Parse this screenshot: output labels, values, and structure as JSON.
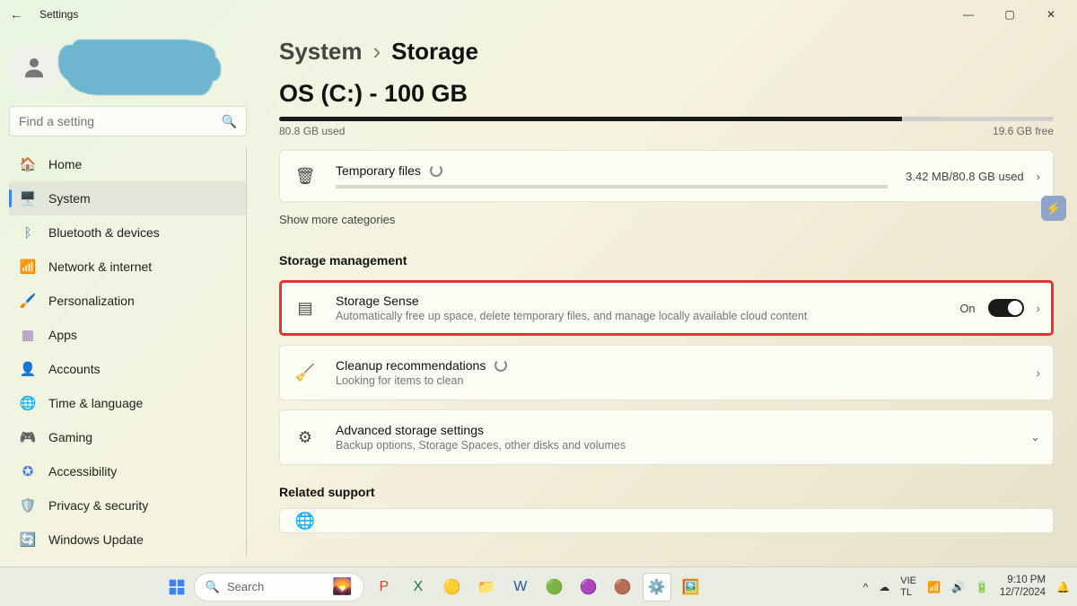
{
  "window": {
    "title": "Settings"
  },
  "search": {
    "placeholder": "Find a setting"
  },
  "sidebar": {
    "items": [
      {
        "icon": "🏠",
        "label": "Home"
      },
      {
        "icon": "🖥️",
        "label": "System"
      },
      {
        "icon": "ᛒ",
        "label": "Bluetooth & devices"
      },
      {
        "icon": "📶",
        "label": "Network & internet"
      },
      {
        "icon": "🖌️",
        "label": "Personalization"
      },
      {
        "icon": "▦",
        "label": "Apps"
      },
      {
        "icon": "👤",
        "label": "Accounts"
      },
      {
        "icon": "🌐",
        "label": "Time & language"
      },
      {
        "icon": "🎮",
        "label": "Gaming"
      },
      {
        "icon": "✪",
        "label": "Accessibility"
      },
      {
        "icon": "🛡️",
        "label": "Privacy & security"
      },
      {
        "icon": "🔄",
        "label": "Windows Update"
      }
    ]
  },
  "breadcrumb": {
    "parent": "System",
    "current": "Storage"
  },
  "drive": {
    "title": "OS (C:) - 100 GB",
    "used_pct": 80.4,
    "used_label": "80.8 GB used",
    "free_label": "19.6 GB free"
  },
  "temp": {
    "title": "Temporary files",
    "usage": "3.42 MB/80.8 GB used"
  },
  "showmore": "Show more categories",
  "section_mgmt": "Storage management",
  "storagesense": {
    "title": "Storage Sense",
    "sub": "Automatically free up space, delete temporary files, and manage locally available cloud content",
    "state": "On"
  },
  "cleanup": {
    "title": "Cleanup recommendations",
    "sub": "Looking for items to clean"
  },
  "advanced": {
    "title": "Advanced storage settings",
    "sub": "Backup options, Storage Spaces, other disks and volumes"
  },
  "section_related": "Related support",
  "taskbar": {
    "search": "Search",
    "lang1": "VIE",
    "lang2": "TL",
    "time": "9:10 PM",
    "date": "12/7/2024"
  }
}
